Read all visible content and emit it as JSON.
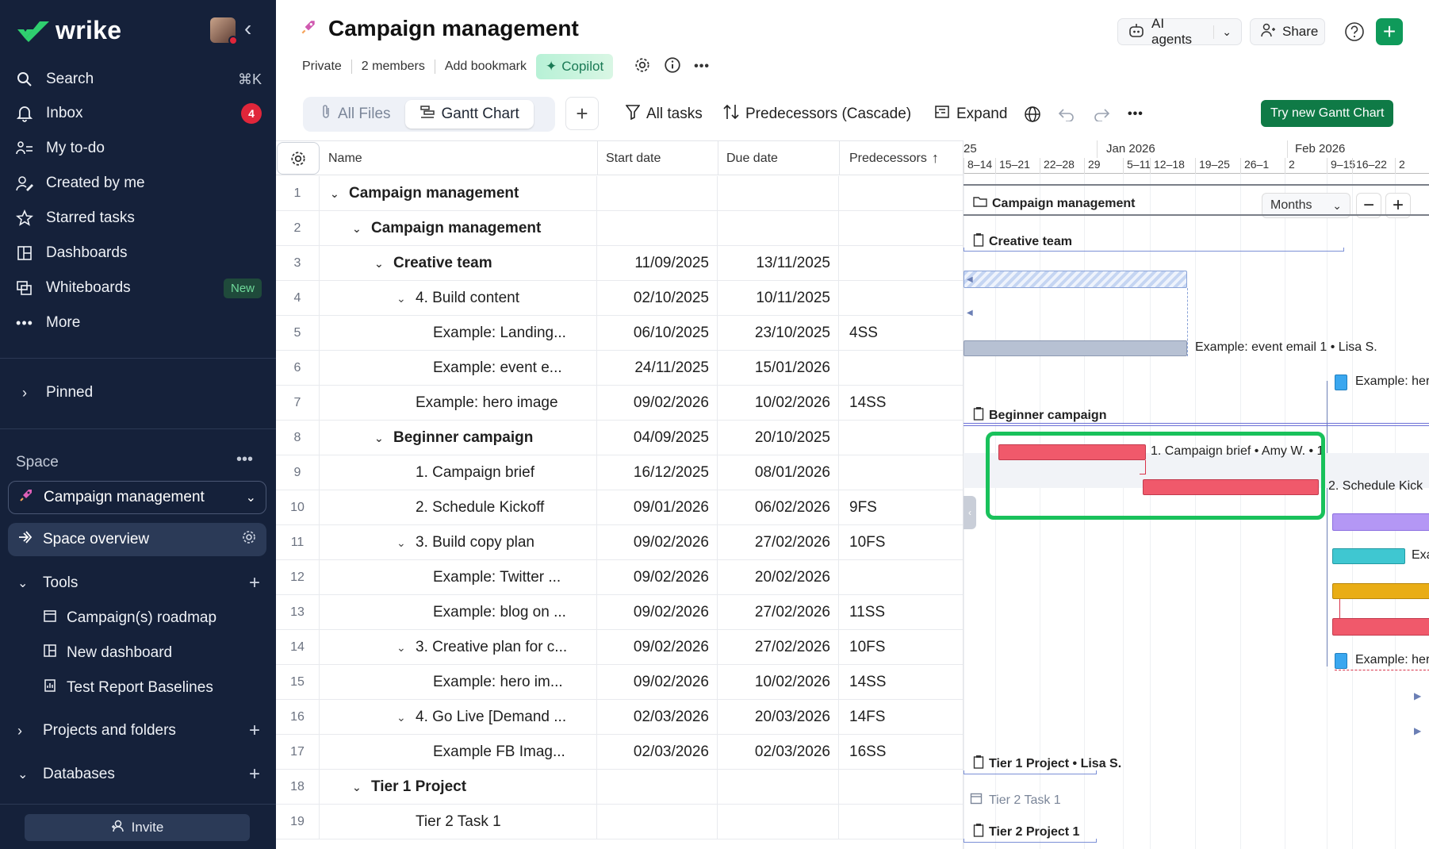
{
  "app": {
    "brand": "wrike",
    "accent": "#0f9a5a"
  },
  "sidebar": {
    "search_label": "Search",
    "search_shortcut": "⌘K",
    "nav": [
      {
        "label": "Inbox",
        "icon": "bell-icon",
        "badge": "4"
      },
      {
        "label": "My to-do",
        "icon": "todo-icon"
      },
      {
        "label": "Created by me",
        "icon": "user-pen-icon"
      },
      {
        "label": "Starred tasks",
        "icon": "star-icon"
      },
      {
        "label": "Dashboards",
        "icon": "dashboard-icon"
      },
      {
        "label": "Whiteboards",
        "icon": "whiteboard-icon",
        "badge": "New"
      },
      {
        "label": "More",
        "icon": "more-icon"
      }
    ],
    "pinned_label": "Pinned",
    "space_label": "Space",
    "space_name": "Campaign management",
    "space_overview": "Space overview",
    "tools_label": "Tools",
    "tools": [
      "Campaign(s) roadmap",
      "New dashboard",
      "Test Report Baselines"
    ],
    "projects_label": "Projects and folders",
    "databases_label": "Databases",
    "invite_label": "Invite"
  },
  "header": {
    "title": "Campaign management",
    "privacy": "Private",
    "members": "2 members",
    "bookmark": "Add bookmark",
    "copilot": "Copilot",
    "ai_agents": "AI agents",
    "share": "Share"
  },
  "toolbar": {
    "tabs": [
      "All Files",
      "Gantt Chart"
    ],
    "active_tab": "Gantt Chart",
    "all_tasks": "All tasks",
    "predecessors": "Predecessors (Cascade)",
    "expand": "Expand",
    "try_new": "Try new Gantt Chart"
  },
  "grid": {
    "columns": [
      "Name",
      "Start date",
      "Due date",
      "Predecessors"
    ],
    "rows": [
      {
        "n": "1",
        "name": "Campaign management",
        "start": "",
        "due": "",
        "pred": "",
        "level": 0,
        "bold": true,
        "chev": true
      },
      {
        "n": "2",
        "name": "Campaign management",
        "start": "",
        "due": "",
        "pred": "",
        "level": 1,
        "bold": true,
        "chev": true
      },
      {
        "n": "3",
        "name": "Creative team",
        "start": "11/09/2025",
        "due": "13/11/2025",
        "pred": "",
        "level": 2,
        "bold": true,
        "chev": true
      },
      {
        "n": "4",
        "name": "4. Build content",
        "start": "02/10/2025",
        "due": "10/11/2025",
        "pred": "",
        "level": 3,
        "bold": false,
        "chev": true
      },
      {
        "n": "5",
        "name": "Example: Landing...",
        "start": "06/10/2025",
        "due": "23/10/2025",
        "pred": "4SS",
        "level": 4,
        "bold": false,
        "chev": false
      },
      {
        "n": "6",
        "name": "Example: event e...",
        "start": "24/11/2025",
        "due": "15/01/2026",
        "pred": "",
        "level": 4,
        "bold": false,
        "chev": false
      },
      {
        "n": "7",
        "name": "Example: hero image",
        "start": "09/02/2026",
        "due": "10/02/2026",
        "pred": "14SS",
        "level": 3,
        "bold": false,
        "chev": false
      },
      {
        "n": "8",
        "name": "Beginner campaign",
        "start": "04/09/2025",
        "due": "20/10/2025",
        "pred": "",
        "level": 2,
        "bold": true,
        "chev": true
      },
      {
        "n": "9",
        "name": "1. Campaign brief",
        "start": "16/12/2025",
        "due": "08/01/2026",
        "pred": "",
        "level": 3,
        "bold": false,
        "chev": false
      },
      {
        "n": "10",
        "name": "2. Schedule Kickoff",
        "start": "09/01/2026",
        "due": "06/02/2026",
        "pred": "9FS",
        "level": 3,
        "bold": false,
        "chev": false
      },
      {
        "n": "11",
        "name": "3. Build copy plan",
        "start": "09/02/2026",
        "due": "27/02/2026",
        "pred": "10FS",
        "level": 3,
        "bold": false,
        "chev": true
      },
      {
        "n": "12",
        "name": "Example: Twitter ...",
        "start": "09/02/2026",
        "due": "20/02/2026",
        "pred": "",
        "level": 4,
        "bold": false,
        "chev": false
      },
      {
        "n": "13",
        "name": "Example: blog on ...",
        "start": "09/02/2026",
        "due": "27/02/2026",
        "pred": "11SS",
        "level": 4,
        "bold": false,
        "chev": false
      },
      {
        "n": "14",
        "name": "3. Creative plan for c...",
        "start": "09/02/2026",
        "due": "27/02/2026",
        "pred": "10FS",
        "level": 3,
        "bold": false,
        "chev": true
      },
      {
        "n": "15",
        "name": "Example: hero im...",
        "start": "09/02/2026",
        "due": "10/02/2026",
        "pred": "14SS",
        "level": 4,
        "bold": false,
        "chev": false
      },
      {
        "n": "16",
        "name": "4. Go Live [Demand ...",
        "start": "02/03/2026",
        "due": "20/03/2026",
        "pred": "14FS",
        "level": 3,
        "bold": false,
        "chev": true
      },
      {
        "n": "17",
        "name": "Example FB Imag...",
        "start": "02/03/2026",
        "due": "02/03/2026",
        "pred": "16SS",
        "level": 4,
        "bold": false,
        "chev": false
      },
      {
        "n": "18",
        "name": "Tier 1 Project",
        "start": "",
        "due": "",
        "pred": "",
        "level": 1,
        "bold": true,
        "chev": true
      },
      {
        "n": "19",
        "name": "Tier 2 Task 1",
        "start": "",
        "due": "",
        "pred": "",
        "level": 3,
        "bold": false,
        "chev": false
      }
    ]
  },
  "gantt": {
    "months": [
      "25",
      "Jan 2026",
      "Feb 2026"
    ],
    "weeks": [
      "8–14",
      "15–21",
      "22–28",
      "29",
      "5–11",
      "12–18",
      "19–25",
      "26–1",
      "2",
      "9–15",
      "16–22",
      "2"
    ],
    "zoom_label": "Months",
    "labels": {
      "project": "Campaign management",
      "creative_team": "Creative team",
      "event_email": "Example: event email 1 • Lisa S.",
      "hero": "Example: her",
      "beginner": "Beginner campaign",
      "brief": "1. Campaign brief • Amy W. • 1",
      "kickoff": "2. Schedule Kick",
      "exa": "Exa",
      "hero2": "Example: her",
      "tier1": "Tier 1 Project • Lisa S.",
      "tier2task": "Tier 2 Task 1",
      "tier2proj": "Tier 2 Project 1"
    },
    "colors": {
      "red": "#f0596b",
      "purple": "#b497f5",
      "teal": "#3fc7d1",
      "gold": "#e9ad15",
      "blue": "#3aa7ef",
      "gray": "#b7c1d3",
      "highlight": "#19c15b"
    }
  }
}
